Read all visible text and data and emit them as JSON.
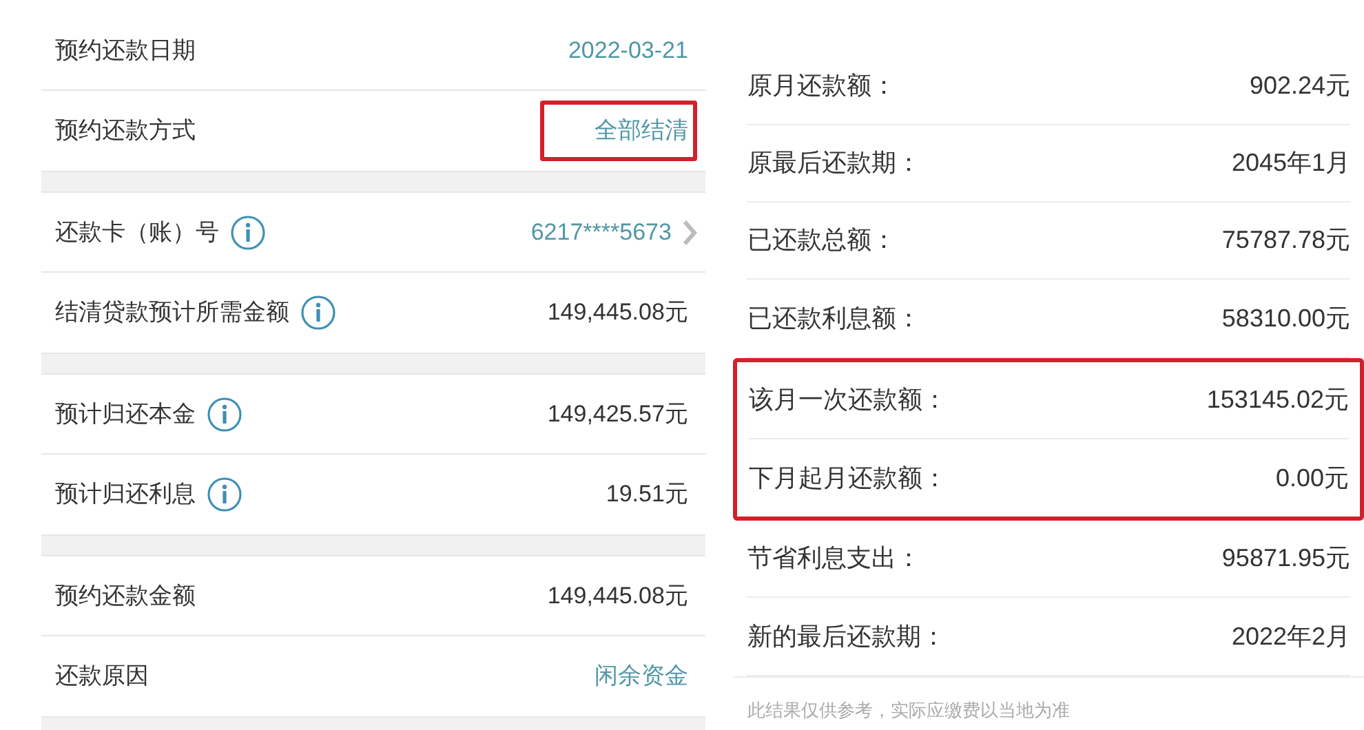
{
  "left": {
    "groups": [
      {
        "rows": [
          {
            "label": "预约还款日期",
            "value": "2022-03-21",
            "info": false,
            "accent": true,
            "chevron": false,
            "highlighted": false
          },
          {
            "label": "预约还款方式",
            "value": "全部结清",
            "info": false,
            "accent": true,
            "chevron": false,
            "highlighted": true
          }
        ]
      },
      {
        "rows": [
          {
            "label": "还款卡（账）号",
            "value": "6217****5673",
            "info": true,
            "accent": true,
            "chevron": true,
            "highlighted": false
          },
          {
            "label": "结清贷款预计所需金额",
            "value": "149,445.08元",
            "info": true,
            "accent": false,
            "chevron": false,
            "highlighted": false
          }
        ]
      },
      {
        "rows": [
          {
            "label": "预计归还本金",
            "value": "149,425.57元",
            "info": true,
            "accent": false,
            "chevron": false,
            "highlighted": false
          },
          {
            "label": "预计归还利息",
            "value": "19.51元",
            "info": true,
            "accent": false,
            "chevron": false,
            "highlighted": false
          }
        ]
      },
      {
        "rows": [
          {
            "label": "预约还款金额",
            "value": "149,445.08元",
            "info": false,
            "accent": false,
            "chevron": false,
            "highlighted": false
          },
          {
            "label": "还款原因",
            "value": "闲余资金",
            "info": false,
            "accent": true,
            "chevron": false,
            "highlighted": false
          }
        ]
      }
    ]
  },
  "right": {
    "sections": [
      {
        "highlighted": false,
        "rows": [
          {
            "label": "原月还款额：",
            "value": "902.24元"
          },
          {
            "label": "原最后还款期：",
            "value": "2045年1月"
          },
          {
            "label": "已还款总额：",
            "value": "75787.78元"
          },
          {
            "label": "已还款利息额：",
            "value": "58310.00元"
          }
        ]
      },
      {
        "highlighted": true,
        "rows": [
          {
            "label": "该月一次还款额：",
            "value": "153145.02元"
          },
          {
            "label": "下月起月还款额：",
            "value": "0.00元"
          }
        ]
      },
      {
        "highlighted": false,
        "rows": [
          {
            "label": "节省利息支出：",
            "value": "95871.95元"
          },
          {
            "label": "新的最后还款期：",
            "value": "2022年2月"
          }
        ]
      }
    ],
    "note": "此结果仅供参考，实际应缴费以当地为准"
  }
}
